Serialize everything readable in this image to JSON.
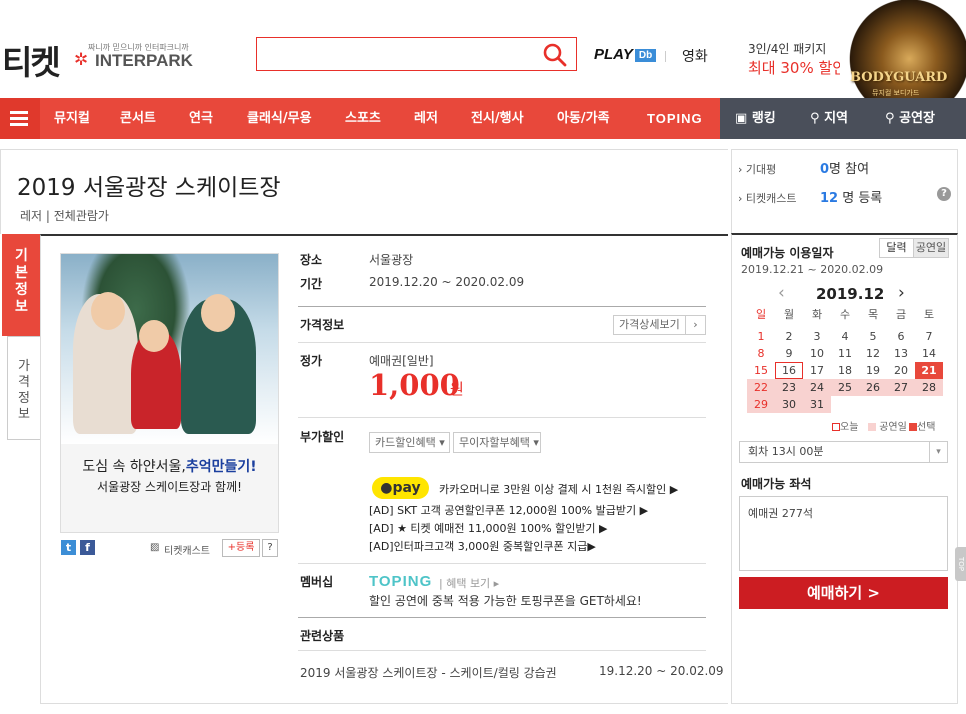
{
  "header": {
    "logo_ko": "티켓",
    "logo_tagline": "짜니까 믿으니까 인터파크니까",
    "logo_brand": "INTERPARK",
    "search_placeholder": "",
    "play_label": "PLAY",
    "play_badge": "Db",
    "movie_label": "영화",
    "promo_line1": "3인/4인 패키지",
    "promo_line2": "최대 30% 할인",
    "promo_banner_title": "BODYGUARD",
    "promo_banner_sub": "뮤지컬 보디가드"
  },
  "nav": {
    "items": [
      "뮤지컬",
      "콘서트",
      "연극",
      "클래식/무용",
      "스포츠",
      "레저",
      "전시/행사",
      "아동/가족",
      "TOPING"
    ],
    "right_items": [
      "랭킹",
      "지역",
      "공연장"
    ]
  },
  "product": {
    "title": "2019 서울광장 스케이트장",
    "subtitle": "레저 | 전체관람가",
    "tabs": [
      "기본정보",
      "가격정보"
    ]
  },
  "poster": {
    "line1_a": "도심 속 하얀서울,",
    "line1_b": "추억만들기!",
    "line2": "서울광장 스케이트장과 함께!",
    "ticketcast_label": "티켓캐스트",
    "register_label": "+등록",
    "help_label": "?"
  },
  "info": {
    "venue_label": "장소",
    "venue_value": "서울광장",
    "period_label": "기간",
    "period_value": "2019.12.20 ~ 2020.02.09",
    "price_info_label": "가격정보",
    "price_detail_btn": "가격상세보기",
    "fixed_price_label": "정가",
    "price_kind": "예매권[일반]",
    "price_value": "1,000",
    "price_unit": "원",
    "discount_label": "부가할인",
    "card_discount": "카드할인혜택",
    "interest_free": "무이자할부혜택",
    "kakao_pay": "pay",
    "kakao_text": "카카오머니로 3만원 이상 결제 시 1천원 즉시할인 ▶",
    "ad_lines": [
      "[AD] SKT 고객 공연할인쿠폰 12,000원 100% 발급받기 ▶",
      "[AD] ★ 티켓 예매전 11,000원 100% 할인받기 ▶",
      "[AD]인터파크고객 3,000원 중복할인쿠폰 지급▶"
    ],
    "membership_label": "멤버십",
    "toping_logo": "TOPING",
    "benefit_link": "혜택 보기",
    "membership_desc": "할인 공연에 중복 적용 가능한 토핑쿠폰을 GET하세요!",
    "related_label": "관련상품",
    "related_name": "2019 서울광장 스케이트장 - 스케이트/컬링 강습권",
    "related_date": "19.12.20 ~ 20.02.09"
  },
  "side_stats": {
    "expect_label": "기대평",
    "expect_num": "0",
    "expect_unit": "명 참여",
    "cast_label": "티켓캐스트",
    "cast_num": "12",
    "cast_unit": "명 등록"
  },
  "booking": {
    "date_label": "예매가능 이용일자",
    "date_range": "2019.12.21 ~ 2020.02.09",
    "toggle_cal": "달력",
    "toggle_day": "공연일",
    "month": "2019.12",
    "weekdays": [
      "일",
      "월",
      "화",
      "수",
      "목",
      "금",
      "토"
    ],
    "weeks": [
      [
        "1",
        "2",
        "3",
        "4",
        "5",
        "6",
        "7"
      ],
      [
        "8",
        "9",
        "10",
        "11",
        "12",
        "13",
        "14"
      ],
      [
        "15",
        "16",
        "17",
        "18",
        "19",
        "20",
        "21"
      ],
      [
        "22",
        "23",
        "24",
        "25",
        "26",
        "27",
        "28"
      ],
      [
        "29",
        "30",
        "31",
        "",
        "",
        "",
        ""
      ]
    ],
    "legend_today": "오늘",
    "legend_perf": "공연일",
    "legend_sel": "선택",
    "session": "회차   13시 00분",
    "seat_label": "예매가능 좌석",
    "seat_value": "예매권 277석",
    "book_btn": "예매하기 >",
    "top_tab": "TOP"
  },
  "colors": {
    "accent": "#e8483b",
    "price": "#e8302a",
    "book": "#cc1d22",
    "nav_right": "#4a4f5a"
  }
}
